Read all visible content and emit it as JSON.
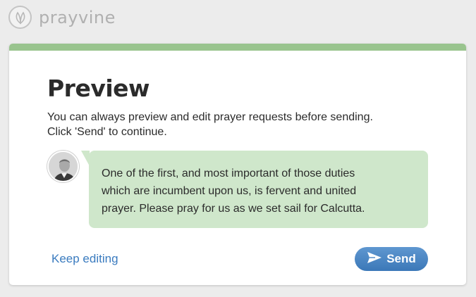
{
  "brand": {
    "name": "prayvine",
    "logo_icon": "leaf-icon"
  },
  "dialog": {
    "title": "Preview",
    "description_line1": "You can always preview and edit prayer requests before sending.",
    "description_line2": "Click 'Send' to continue.",
    "accent_color": "#99c48e"
  },
  "message": {
    "avatar_icon": "portrait-avatar",
    "line1": "One of the first, and most important of those duties",
    "line2": "which are incumbent upon us, is fervent and united",
    "line3": "prayer. Please pray for us as we set sail for Calcutta.",
    "bubble_color": "#cfe7cb"
  },
  "actions": {
    "keep_editing_label": "Keep editing",
    "send_label": "Send",
    "send_icon": "paper-plane-icon",
    "link_color": "#3a7bbf"
  }
}
